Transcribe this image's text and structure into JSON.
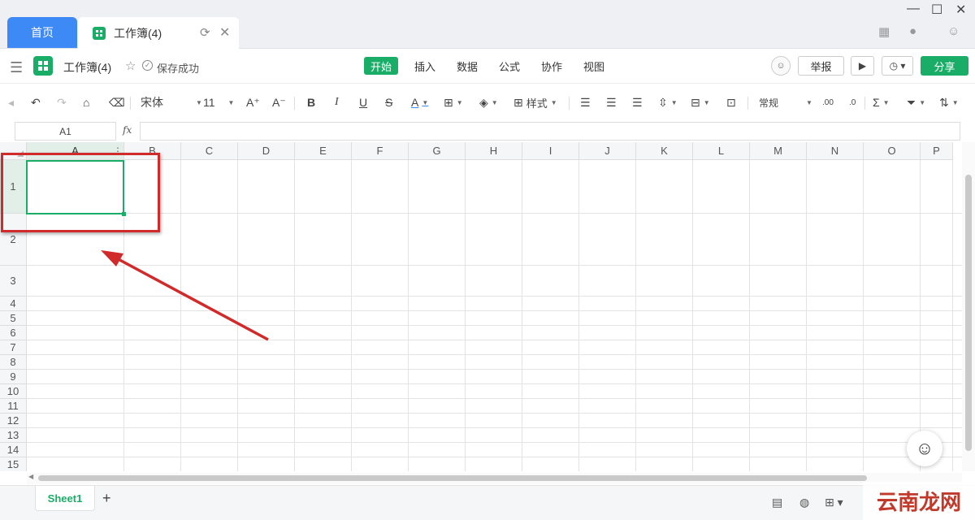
{
  "tabs": {
    "home_label": "首页",
    "doc_label": "工作簿(4)"
  },
  "window": {
    "minimize": "—",
    "maximize": "☐",
    "close": "✕"
  },
  "doc": {
    "title": "工作簿(4)",
    "status": "保存成功",
    "menu": [
      "开始",
      "插入",
      "数据",
      "公式",
      "协作",
      "视图"
    ],
    "active_menu": "开始",
    "report_label": "举报",
    "share_label": "分享"
  },
  "toolbar": {
    "font_name": "宋体",
    "font_size": "11",
    "style_label": "样式",
    "number_format": "常规",
    "inc_font": "A⁺",
    "dec_font": "A⁻",
    "bold": "B",
    "italic": "I",
    "underline": "U",
    "strike": "S",
    "font_color": "A",
    "sum": "Σ"
  },
  "formula": {
    "cell_ref": "A1",
    "fx_label": "fx",
    "value": ""
  },
  "grid": {
    "columns": [
      "A",
      "B",
      "C",
      "D",
      "E",
      "F",
      "G",
      "H",
      "I",
      "J",
      "K",
      "L",
      "M",
      "N",
      "O",
      "P"
    ],
    "rows": [
      "1",
      "2",
      "3",
      "4",
      "5",
      "6",
      "7",
      "8",
      "9",
      "10",
      "11",
      "12",
      "13",
      "14",
      "15"
    ],
    "selected_cell": "A1"
  },
  "bottom": {
    "sheet_name": "Sheet1",
    "add_sheet": "+"
  },
  "watermark": "云南龙网",
  "colors": {
    "accent_green": "#1aad67",
    "tab_blue": "#3d8af7",
    "annotation_red": "#d02a2a"
  }
}
